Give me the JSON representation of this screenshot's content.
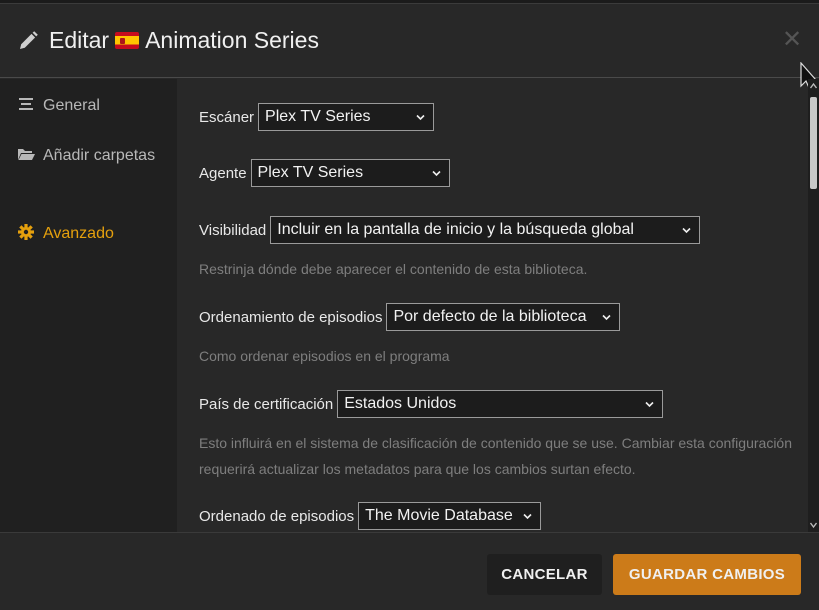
{
  "header": {
    "title_prefix": "Editar",
    "title_name": "Animation Series",
    "flag_icon": "spain-flag-icon",
    "close_symbol": "✕"
  },
  "sidebar": {
    "items": [
      {
        "label": "General",
        "icon": "lines-icon",
        "active": false
      },
      {
        "label": "Añadir carpetas",
        "icon": "folder-open-icon",
        "active": false
      },
      {
        "label": "Avanzado",
        "icon": "gear-icon",
        "active": true
      }
    ]
  },
  "form": {
    "scanner": {
      "label": "Escáner",
      "value": "Plex TV Series"
    },
    "agent": {
      "label": "Agente",
      "value": "Plex TV Series"
    },
    "visibility": {
      "label": "Visibilidad",
      "value": "Incluir en la pantalla de inicio y la búsqueda global",
      "help": "Restrinja dónde debe aparecer el contenido de esta biblioteca."
    },
    "episode_order": {
      "label": "Ordenamiento de episodios",
      "value": "Por defecto de la biblioteca",
      "help": "Como ordenar episodios en el programa"
    },
    "cert_country": {
      "label": "País de certificación",
      "value": "Estados Unidos",
      "help": "Esto influirá en el sistema de clasificación de contenido que se use. Cambiar esta configuración requerirá actualizar los metadatos para que los cambios surtan efecto."
    },
    "episode_ordering": {
      "label": "Ordenado de episodios",
      "value": "The Movie Database"
    }
  },
  "footer": {
    "cancel_label": "CANCELAR",
    "save_label": "GUARDAR CAMBIOS"
  },
  "colors": {
    "accent": "#e5a00d",
    "save_button": "#cc7b19",
    "background": "#282828",
    "sidebar": "#202020"
  }
}
